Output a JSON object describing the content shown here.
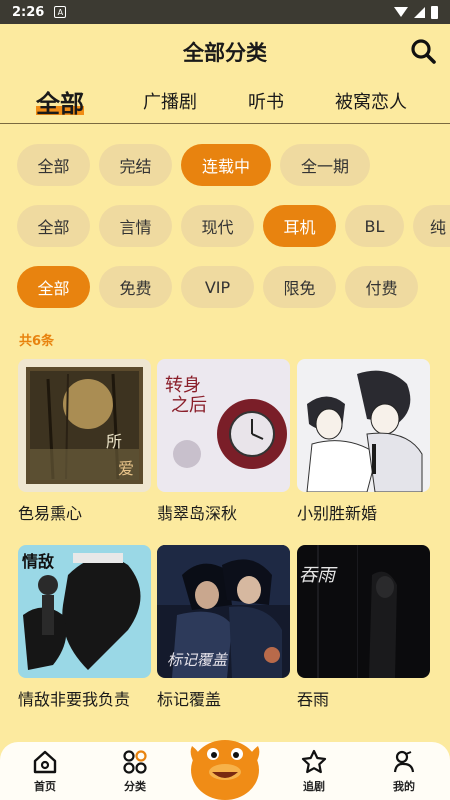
{
  "status_bar": {
    "time": "2:26",
    "notif_glyph": "A"
  },
  "header": {
    "title": "全部分类"
  },
  "tabs": [
    {
      "label": "全部",
      "active": true
    },
    {
      "label": "广播剧",
      "active": false
    },
    {
      "label": "听书",
      "active": false
    },
    {
      "label": "被窝恋人",
      "active": false
    }
  ],
  "filters": {
    "status": [
      {
        "label": "全部",
        "active": false
      },
      {
        "label": "完结",
        "active": false
      },
      {
        "label": "连载中",
        "active": true
      },
      {
        "label": "全一期",
        "active": false
      }
    ],
    "genre": [
      {
        "label": "全部",
        "active": false
      },
      {
        "label": "言情",
        "active": false
      },
      {
        "label": "现代",
        "active": false
      },
      {
        "label": "耳机",
        "active": true
      },
      {
        "label": "BL",
        "active": false
      },
      {
        "label": "纯",
        "active": false
      }
    ],
    "price": [
      {
        "label": "全部",
        "active": true
      },
      {
        "label": "免费",
        "active": false
      },
      {
        "label": "VIP",
        "active": false
      },
      {
        "label": "限免",
        "active": false
      },
      {
        "label": "付费",
        "active": false
      }
    ]
  },
  "count_text": "共6条",
  "items": [
    {
      "title": "色易熏心"
    },
    {
      "title": "翡翠岛深秋"
    },
    {
      "title": "小别胜新婚"
    },
    {
      "title": "情敌非要我负责"
    },
    {
      "title": "标记覆盖"
    },
    {
      "title": "吞雨"
    }
  ],
  "bottom_nav": [
    {
      "label": "首页",
      "icon": "home-icon"
    },
    {
      "label": "分类",
      "icon": "category-icon"
    },
    {
      "label": "追剧",
      "icon": "star-icon"
    },
    {
      "label": "我的",
      "icon": "profile-icon"
    }
  ],
  "colors": {
    "background": "#fcea9f",
    "accent": "#e8830f",
    "chip": "#efdaa0"
  }
}
